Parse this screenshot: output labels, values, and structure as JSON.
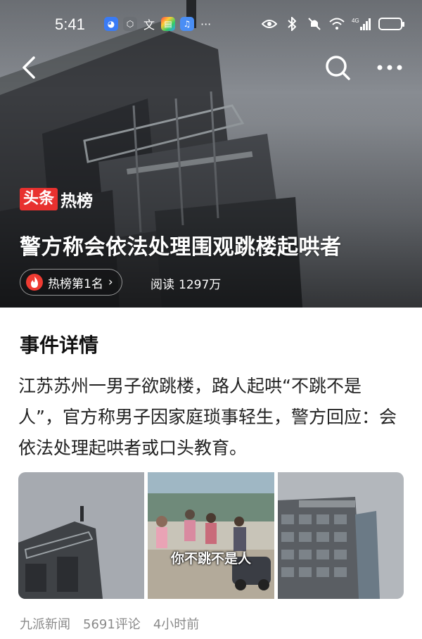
{
  "status_bar": {
    "time": "5:41",
    "network": "4G",
    "app_icons": [
      "assistant-app-icon",
      "shield-app-icon",
      "translate-app-icon",
      "colorful-app-icon",
      "music-app-icon"
    ],
    "overflow": "···"
  },
  "nav": {
    "back_icon": "chevron-left-icon",
    "search_icon": "search-icon",
    "more_icon": "more-dots-icon"
  },
  "hero": {
    "brand_badge": "头条",
    "brand_text": "热榜",
    "title": "警方称会依法处理围观跳楼起哄者",
    "rank_label": "热榜第1名",
    "rank_chevron": "›",
    "read_label": "阅读",
    "read_count": "1297万"
  },
  "article": {
    "section_title": "事件详情",
    "summary": "江苏苏州一男子欲跳楼，路人起哄“不跳不是人”，官方称男子因家庭琐事轻生，警方回应：会依法处理起哄者或口头教育。",
    "images": [
      {
        "caption": ""
      },
      {
        "caption": "你不跳不是人"
      },
      {
        "caption": ""
      }
    ],
    "source": "九派新闻",
    "comments": "5691评论",
    "time_ago": "4小时前"
  },
  "colors": {
    "brand_red": "#e8312f",
    "flame_red": "#ee3b32",
    "meta_gray": "#8a8a8a"
  }
}
